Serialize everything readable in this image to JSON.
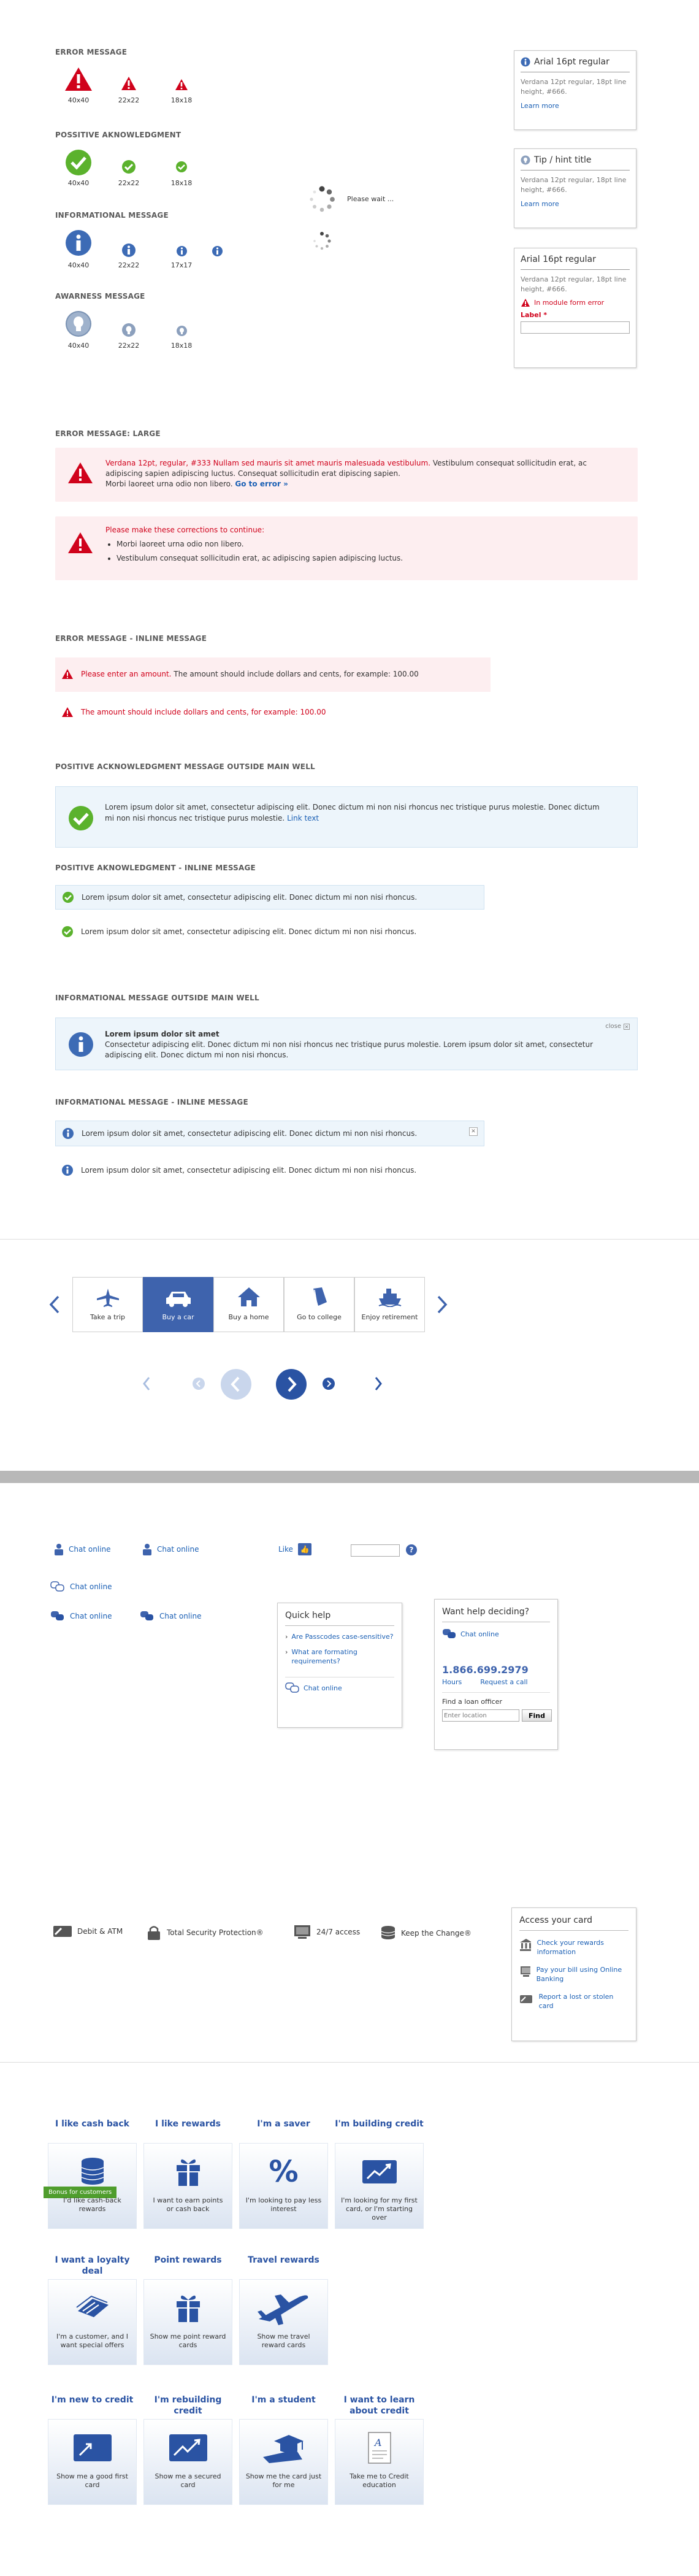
{
  "colors": {
    "error": "#d0021b",
    "success": "#5bb22d",
    "info": "#3d6bb5",
    "link": "#1a5fb4",
    "brand": "#3e63ad"
  },
  "icon_messages": {
    "error": {
      "title": "ERROR MESSAGE",
      "sizes": [
        "40x40",
        "22x22",
        "18x18"
      ]
    },
    "positive": {
      "title": "POSSITIVE AKNOWLEDGMENT",
      "sizes": [
        "40x40",
        "22x22",
        "18x18"
      ]
    },
    "info": {
      "title": "INFORMATIONAL  MESSAGE",
      "sizes": [
        "40x40",
        "22x22",
        "17x17"
      ]
    },
    "awareness": {
      "title": "AWARNESS MESSAGE",
      "sizes": [
        "40x40",
        "22x22",
        "18x18"
      ]
    }
  },
  "loader": {
    "label": "Please wait ..."
  },
  "cards": {
    "card1": {
      "title": "Arial 16pt regular",
      "body": "Verdana 12pt regular, 18pt line height, #666.",
      "link": "Learn more"
    },
    "card2": {
      "title": "Tip / hint title",
      "body": "Verdana 12pt regular, 18pt line height, #666.",
      "link": "Learn more"
    },
    "card3": {
      "title": "Arial 16pt regular",
      "body": "Verdana 12pt regular, 18pt line height, #666.",
      "error": "In module form error",
      "label": "Label *"
    }
  },
  "error_large": {
    "title": "ERROR MESSAGE: LARGE",
    "box1": {
      "red": "Verdana 12pt, regular, #333 Nullam sed mauris sit amet mauris malesuada vestibulum.",
      "rest": " Vestibulum consequat sollicitudin erat, ac adipiscing sapien adipiscing luctus. Consequat sollicitudin erat dipiscing sapien.",
      "line3": "Morbi laoreet urna odio non libero. ",
      "link": "Go to error »"
    },
    "box2": {
      "title": "Please make these corrections to continue:",
      "items": [
        "Morbi laoreet urna odio non libero.",
        "Vestibulum consequat sollicitudin erat, ac adipiscing sapien adipiscing luctus."
      ]
    }
  },
  "error_inline": {
    "title": "ERROR MESSAGE - INLINE MESSAGE",
    "row1_red": "Please enter an amount.",
    "row1_rest": " The amount should include dollars and cents, for example: 100.00",
    "row2": "The amount should include dollars and cents, for example: 100.00"
  },
  "positive_outside": {
    "title": "POSITIVE ACKNOWLEDGMENT MESSAGE OUTSIDE MAIN WELL",
    "text": "Lorem ipsum dolor sit amet, consectetur adipiscing elit. Donec dictum mi non nisi rhoncus nec tristique purus molestie.  Donec dictum mi non nisi rhoncus nec tristique purus molestie. ",
    "link": "Link text"
  },
  "positive_inline": {
    "title": "POSITIVE AKNOWLEDGMENT - INLINE MESSAGE",
    "row1": "Lorem ipsum dolor sit amet, consectetur adipiscing elit. Donec dictum mi non nisi rhoncus.",
    "row2": "Lorem ipsum dolor sit amet, consectetur adipiscing elit. Donec dictum mi non nisi rhoncus."
  },
  "info_outside": {
    "title": "INFORMATIONAL  MESSAGE OUTSIDE MAIN WELL",
    "heading": "Lorem ipsum dolor sit amet",
    "text": "Consectetur adipiscing elit. Donec dictum mi non nisi rhoncus nec tristique purus molestie. Lorem ipsum dolor sit amet, consectetur adipiscing elit. Donec dictum mi non nisi rhoncus.",
    "close": "close"
  },
  "info_inline": {
    "title": "INFORMATIONAL  MESSAGE - INLINE MESSAGE",
    "row1": "Lorem ipsum dolor sit amet, consectetur adipiscing elit. Donec dictum mi non nisi rhoncus.",
    "row2": "Lorem ipsum dolor sit amet, consectetur adipiscing elit. Donec dictum mi non nisi rhoncus."
  },
  "carousel": {
    "tabs": [
      "Take a trip",
      "Buy a car",
      "Buy a home",
      "Go to college",
      "Enjoy retirement"
    ],
    "active_index": 1
  },
  "chat": {
    "label": "Chat online",
    "like": "Like",
    "quick_help": {
      "title": "Quick help",
      "items": [
        "Are Passcodes case-sensitive?",
        "What are formating requirements?"
      ],
      "chat": "Chat online"
    },
    "want_help": {
      "title": "Want help deciding?",
      "chat": "Chat online",
      "phone": "1.866.699.2979",
      "hours": "Hours",
      "request": "Request a call",
      "find_label": "Find a loan officer",
      "placeholder": "Enter location",
      "find_button": "Find"
    }
  },
  "features": {
    "items": [
      "Debit & ATM",
      "Total Security Protection®",
      "24/7 access",
      "Keep the Change®"
    ],
    "access": {
      "title": "Access your card",
      "items": [
        "Check your rewards information",
        "Pay your bill using Online Banking",
        "Report a lost or stolen card"
      ]
    }
  },
  "tiles": {
    "row1": [
      {
        "title": "I like cash back",
        "desc": "I'd like cash-back rewards",
        "ribbon": "Bonus for customers"
      },
      {
        "title": "I like rewards",
        "desc": "I want to earn points or cash back"
      },
      {
        "title": "I'm a saver",
        "desc": "I'm looking to pay less interest"
      },
      {
        "title": "I'm building credit",
        "desc": "I'm looking for my first card, or I'm starting over"
      }
    ],
    "row2": [
      {
        "title": "I want a loyalty deal",
        "desc": "I'm a customer, and I want special offers"
      },
      {
        "title": "Point rewards",
        "desc": "Show me point reward cards"
      },
      {
        "title": "Travel rewards",
        "desc": "Show me travel reward cards"
      }
    ],
    "row3": [
      {
        "title": "I'm new to credit",
        "desc": "Show me a good first card"
      },
      {
        "title": "I'm rebuilding credit",
        "desc": "Show me a secured card"
      },
      {
        "title": "I'm a student",
        "desc": "Show me the card just for me"
      },
      {
        "title": "I want to learn about credit",
        "desc": "Take me to Credit education"
      }
    ]
  }
}
